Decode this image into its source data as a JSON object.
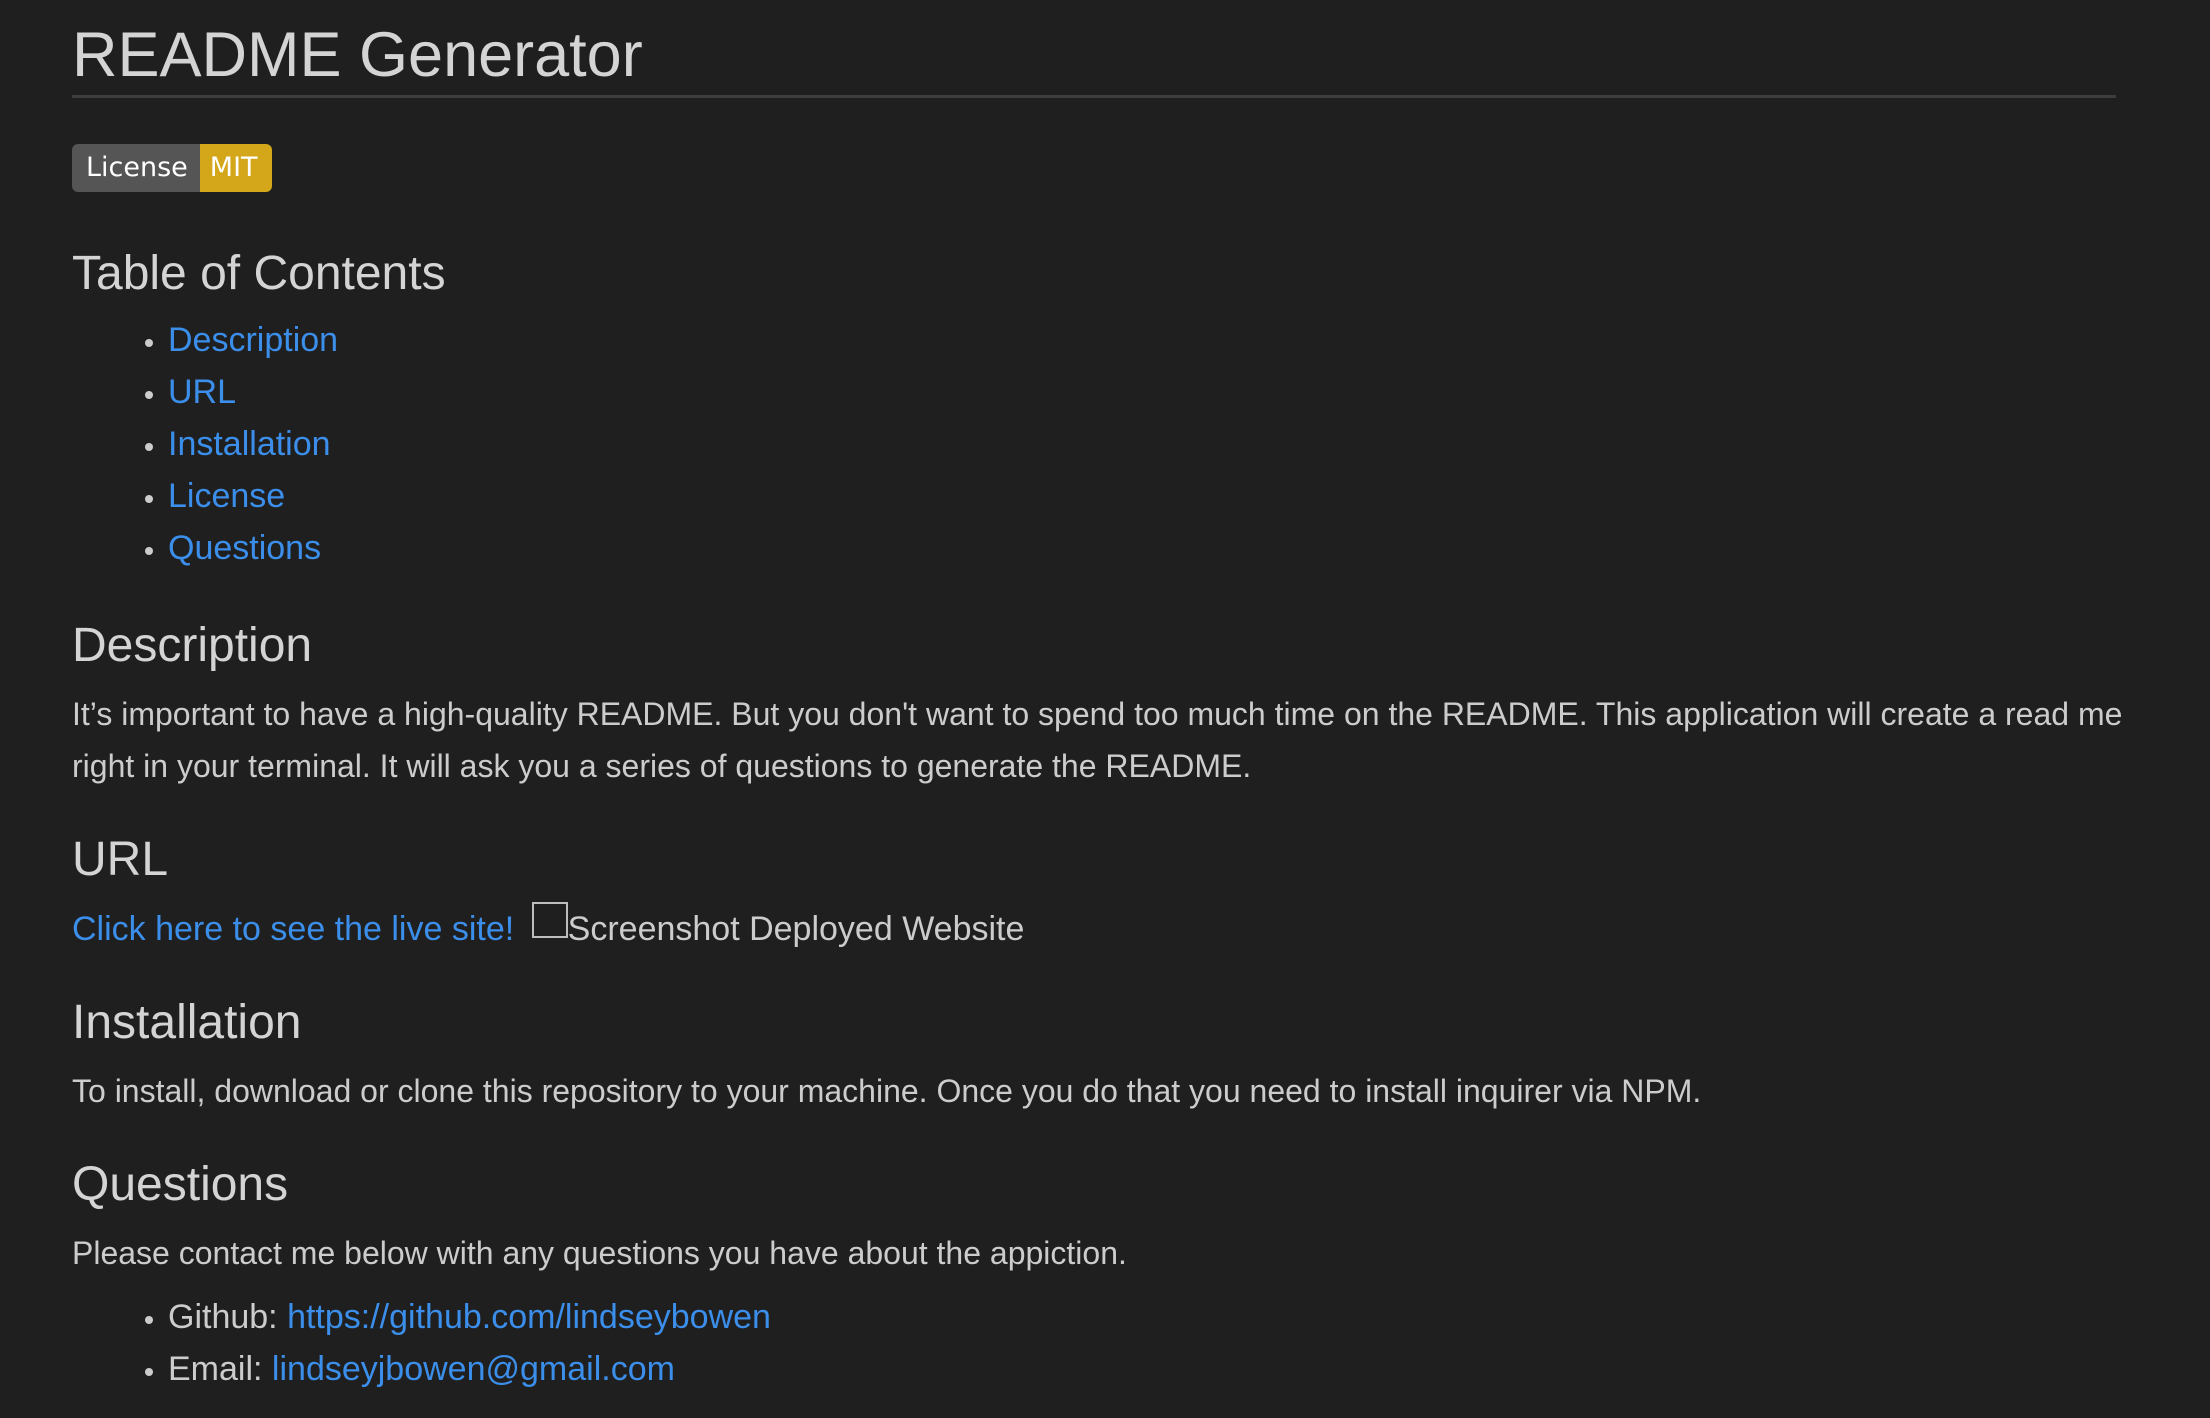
{
  "title": "README Generator",
  "badge": {
    "label": "License",
    "value": "MIT",
    "label_color": "#555555",
    "value_color": "#d4a71a"
  },
  "toc": {
    "heading": "Table of Contents",
    "items": [
      "Description",
      "URL",
      "Installation",
      "License",
      "Questions"
    ]
  },
  "description": {
    "heading": "Description",
    "text": "It’s important to have a high-quality README. But you don't want to spend too much time on the README. This application will create a read me right in your terminal. It will ask you a series of questions to generate the README."
  },
  "url": {
    "heading": "URL",
    "link_text": "Click here to see the live site!",
    "image_alt": "Screenshot Deployed Website"
  },
  "installation": {
    "heading": "Installation",
    "text": "To install, download or clone this repository to your machine. Once you do that you need to install inquirer via NPM."
  },
  "questions": {
    "heading": "Questions",
    "text": "Please contact me below with any questions you have about the appiction.",
    "contacts": [
      {
        "label": "Github: ",
        "value": "https://github.com/lindseybowen"
      },
      {
        "label": "Email: ",
        "value": "lindseyjbowen@gmail.com"
      }
    ]
  },
  "colors": {
    "background": "#1f1f1f",
    "text": "#cccccc",
    "link": "#3b8eea",
    "heading": "#d4d4d4"
  }
}
